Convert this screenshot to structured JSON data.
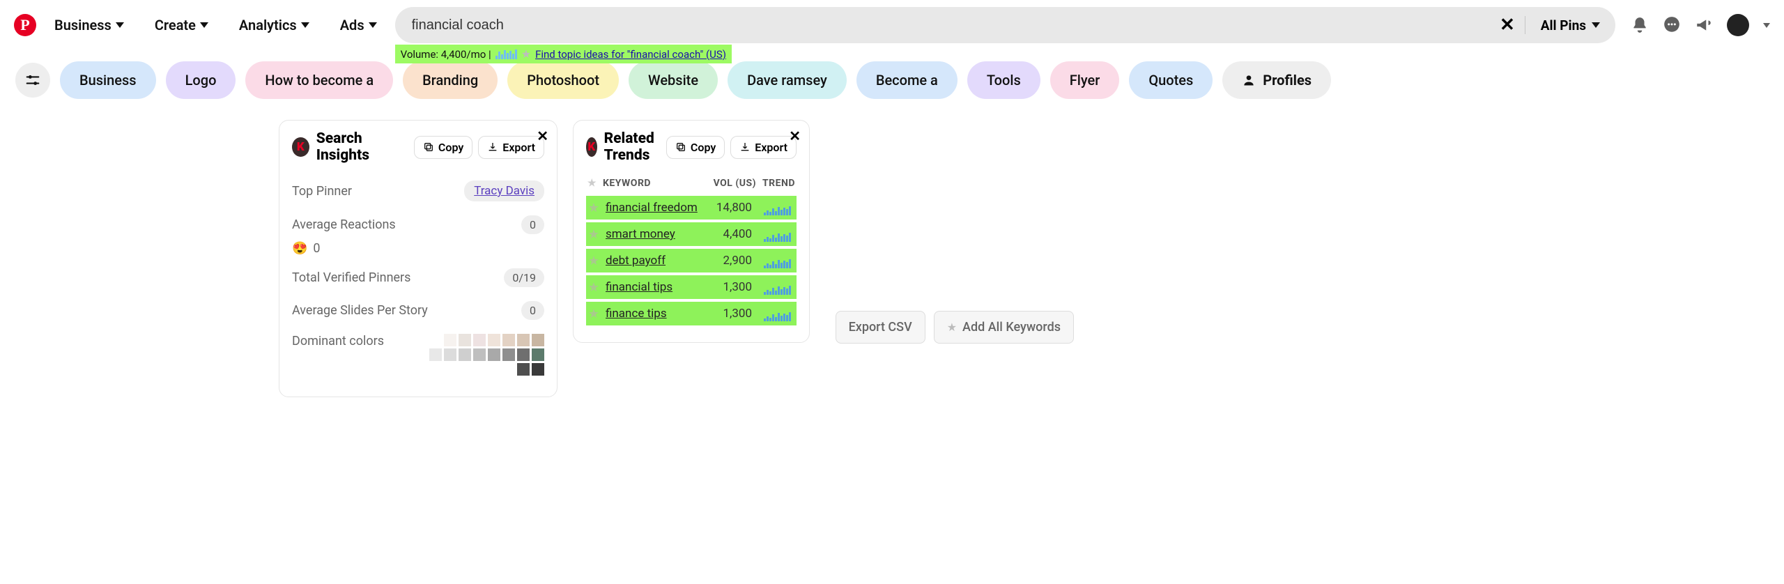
{
  "nav": {
    "business": "Business",
    "create": "Create",
    "analytics": "Analytics",
    "ads": "Ads"
  },
  "search": {
    "value": "financial coach",
    "all_pins": "All Pins",
    "volume_label": "Volume: 4,400/mo |",
    "topic_link": "Find topic ideas for \"financial coach\" (US)"
  },
  "chips": {
    "business": "Business",
    "logo": "Logo",
    "howto": "How to become a",
    "branding": "Branding",
    "photoshoot": "Photoshoot",
    "website": "Website",
    "dave": "Dave ramsey",
    "become": "Become a",
    "tools": "Tools",
    "flyer": "Flyer",
    "quotes": "Quotes",
    "profiles": "Profiles"
  },
  "insights": {
    "title": "Search Insights",
    "copy": "Copy",
    "export": "Export",
    "top_pinner_label": "Top Pinner",
    "top_pinner_value": "Tracy Davis",
    "avg_reactions_label": "Average Reactions",
    "avg_reactions_value": "0",
    "heart_value": "0",
    "verified_label": "Total Verified Pinners",
    "verified_value": "0/19",
    "slides_label": "Average Slides Per Story",
    "slides_value": "0",
    "colors_label": "Dominant colors",
    "swatches": [
      "#ffffff",
      "#f6f2ef",
      "#e9e3de",
      "#eee2e2",
      "#efe3da",
      "#e3d2c4",
      "#d8c6b5",
      "#c8b6a2",
      "#e8e8e8",
      "#dcdcdc",
      "#cfcfcf",
      "#bfbfbf",
      "#a9a9a9",
      "#8f8f8f",
      "#6f6f6f",
      "#5c7b6c",
      "#4f4f4f",
      "#3a3a3a"
    ]
  },
  "trends": {
    "title": "Related Trends",
    "copy": "Copy",
    "export": "Export",
    "col_keyword": "KEYWORD",
    "col_vol": "VOL (US)",
    "col_trend": "TREND",
    "rows": [
      {
        "kw": "financial freedom",
        "vol": "14,800"
      },
      {
        "kw": "smart money",
        "vol": "4,400"
      },
      {
        "kw": "debt payoff",
        "vol": "2,900"
      },
      {
        "kw": "financial tips",
        "vol": "1,300"
      },
      {
        "kw": "finance tips",
        "vol": "1,300"
      }
    ],
    "export_csv": "Export CSV",
    "add_all": "Add All Keywords"
  }
}
